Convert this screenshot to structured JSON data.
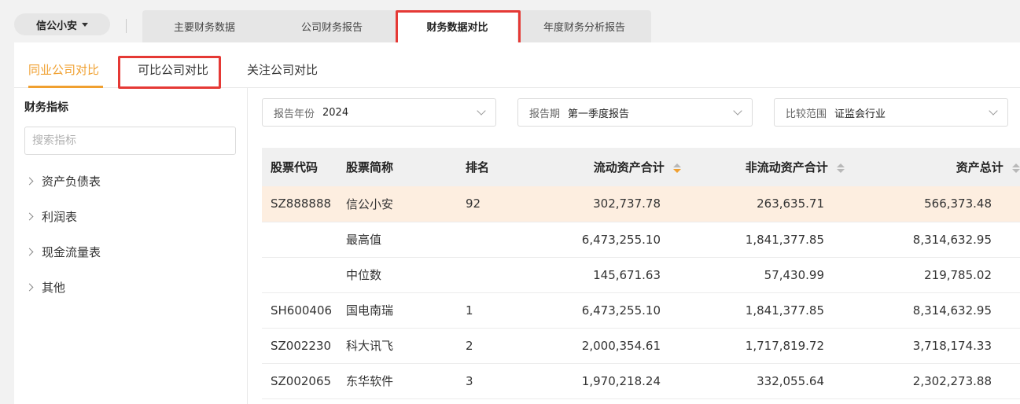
{
  "header": {
    "company": "信公小安",
    "tabs": [
      "主要财务数据",
      "公司财务报告",
      "财务数据对比",
      "年度财务分析报告"
    ]
  },
  "subtabs": [
    "同业公司对比",
    "可比公司对比",
    "关注公司对比"
  ],
  "sidebar": {
    "title": "财务指标",
    "search_placeholder": "搜索指标",
    "items": [
      "资产负债表",
      "利润表",
      "现金流量表",
      "其他"
    ]
  },
  "filters": [
    {
      "label": "报告年份",
      "value": "2024"
    },
    {
      "label": "报告期",
      "value": "第一季度报告"
    },
    {
      "label": "比较范围",
      "value": "证监会行业"
    }
  ],
  "table": {
    "headers": [
      "股票代码",
      "股票简称",
      "排名",
      "流动资产合计",
      "非流动资产合计",
      "资产总计"
    ],
    "rows": [
      [
        "SZ888888",
        "信公小安",
        "92",
        "302,737.78",
        "263,635.71",
        "566,373.48"
      ],
      [
        "",
        "最高值",
        "",
        "6,473,255.10",
        "1,841,377.85",
        "8,314,632.95"
      ],
      [
        "",
        "中位数",
        "",
        "145,671.63",
        "57,430.99",
        "219,785.02"
      ],
      [
        "SH600406",
        "国电南瑞",
        "1",
        "6,473,255.10",
        "1,841,377.85",
        "8,314,632.95"
      ],
      [
        "SZ002230",
        "科大讯飞",
        "2",
        "2,000,354.61",
        "1,717,819.72",
        "3,718,174.33"
      ],
      [
        "SZ002065",
        "东华软件",
        "3",
        "1,970,218.24",
        "332,055.64",
        "2,302,273.88"
      ]
    ]
  },
  "colors": {
    "accent": "#f0a030",
    "highlight_row": "#fdeee0",
    "annotation": "#e53935"
  }
}
